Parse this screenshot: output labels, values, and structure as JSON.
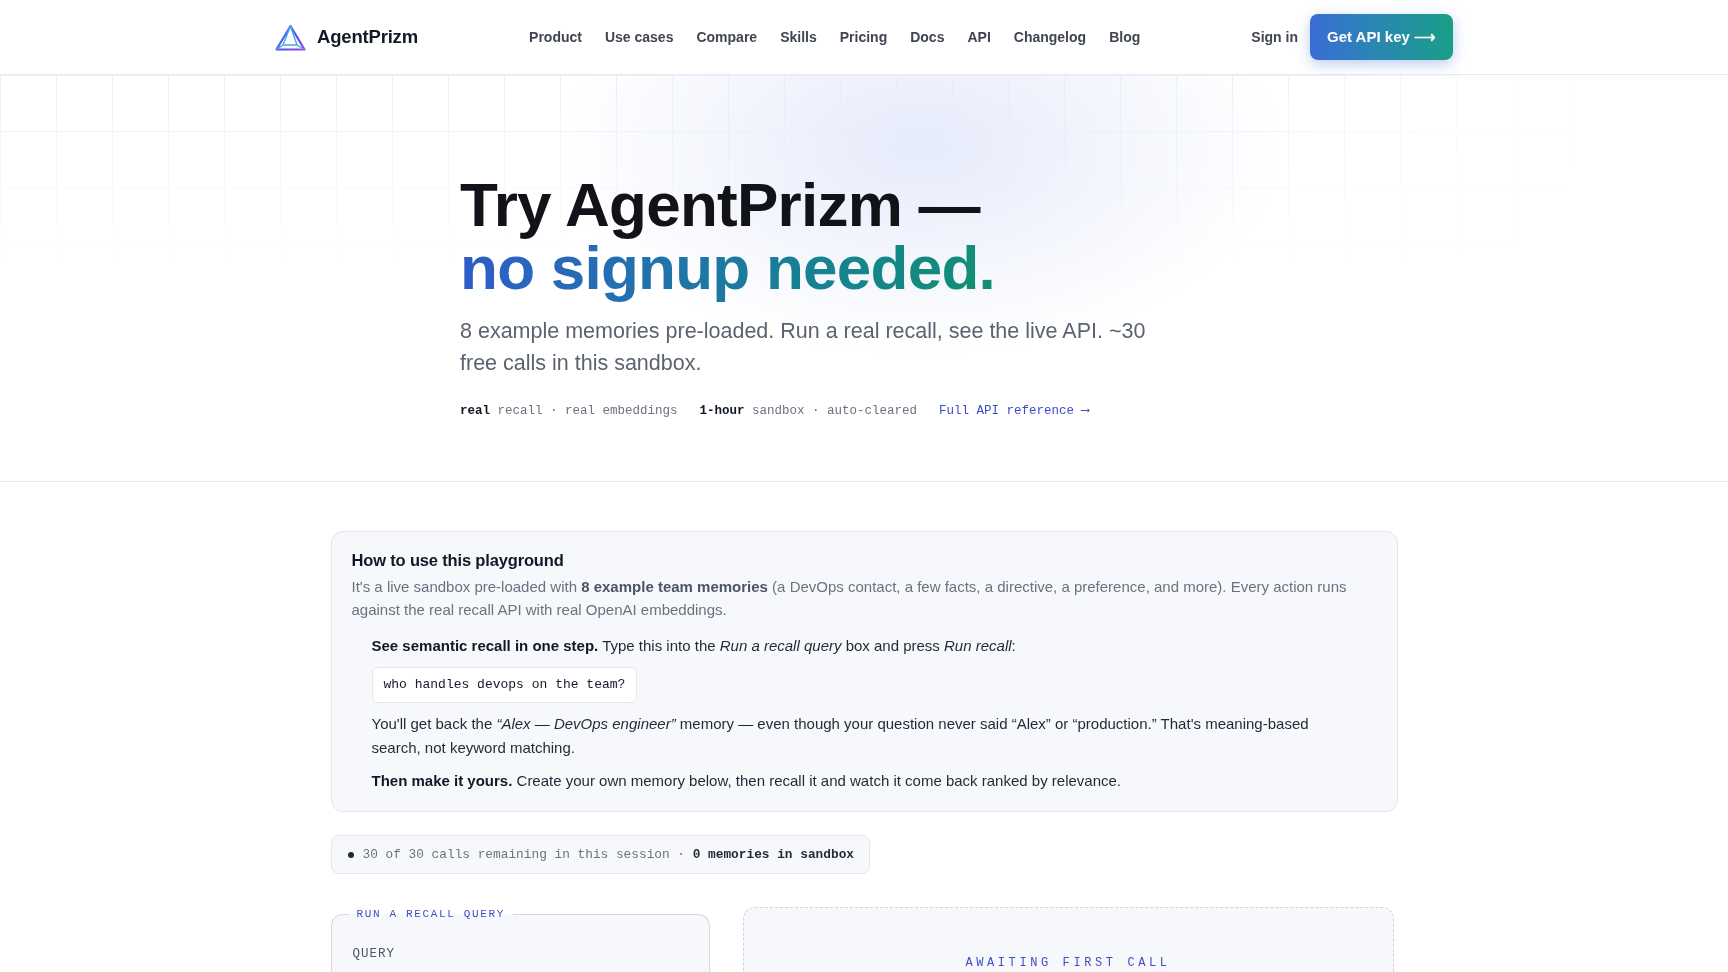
{
  "header": {
    "brand": "AgentPrizm",
    "nav": [
      "Product",
      "Use cases",
      "Compare",
      "Skills",
      "Pricing",
      "Docs",
      "API",
      "Changelog",
      "Blog"
    ],
    "sign_in": "Sign in",
    "cta": "Get API key ⟶"
  },
  "hero": {
    "title": "Try AgentPrizm —",
    "title_highlight": "no signup needed.",
    "subtitle": "8 example memories pre-loaded. Run a real recall, see the live API. ~30 free calls in this sandbox.",
    "tags": [
      "**real** recall · real embeddings",
      "**1-hour** sandbox · auto-cleared"
    ],
    "api_link": "Full API reference ⟶"
  },
  "guide": {
    "title": "How to use this playground",
    "intro": "It's a live sandbox pre-loaded with **8 example team memories** (a DevOps contact, a few facts, a directive, a preference, and more). Every action runs against the real recall API with real OpenAI embeddings.",
    "steps": [
      {
        "kind": "text",
        "text": "**See semantic recall in one step.** Type this into the *Run a recall query* box and press *Run recall*:"
      },
      {
        "kind": "code",
        "text": "who handles devops on the team?"
      },
      {
        "kind": "text",
        "text": "You'll get back the *“Alex — DevOps engineer”* memory — even though your question never said “Alex” or “production.” That's meaning-based search, not keyword matching."
      },
      {
        "kind": "text",
        "text": "**Then make it yours.** Create your own memory below, then recall it and watch it come back ranked by relevance."
      }
    ]
  },
  "session_status": "30 of 30 calls remaining in this session · **0 memories in sandbox**",
  "query_panel": {
    "legend": "RUN A RECALL QUERY",
    "field_label": "QUERY"
  },
  "result_panel": {
    "status": "AWAITING FIRST CALL"
  }
}
